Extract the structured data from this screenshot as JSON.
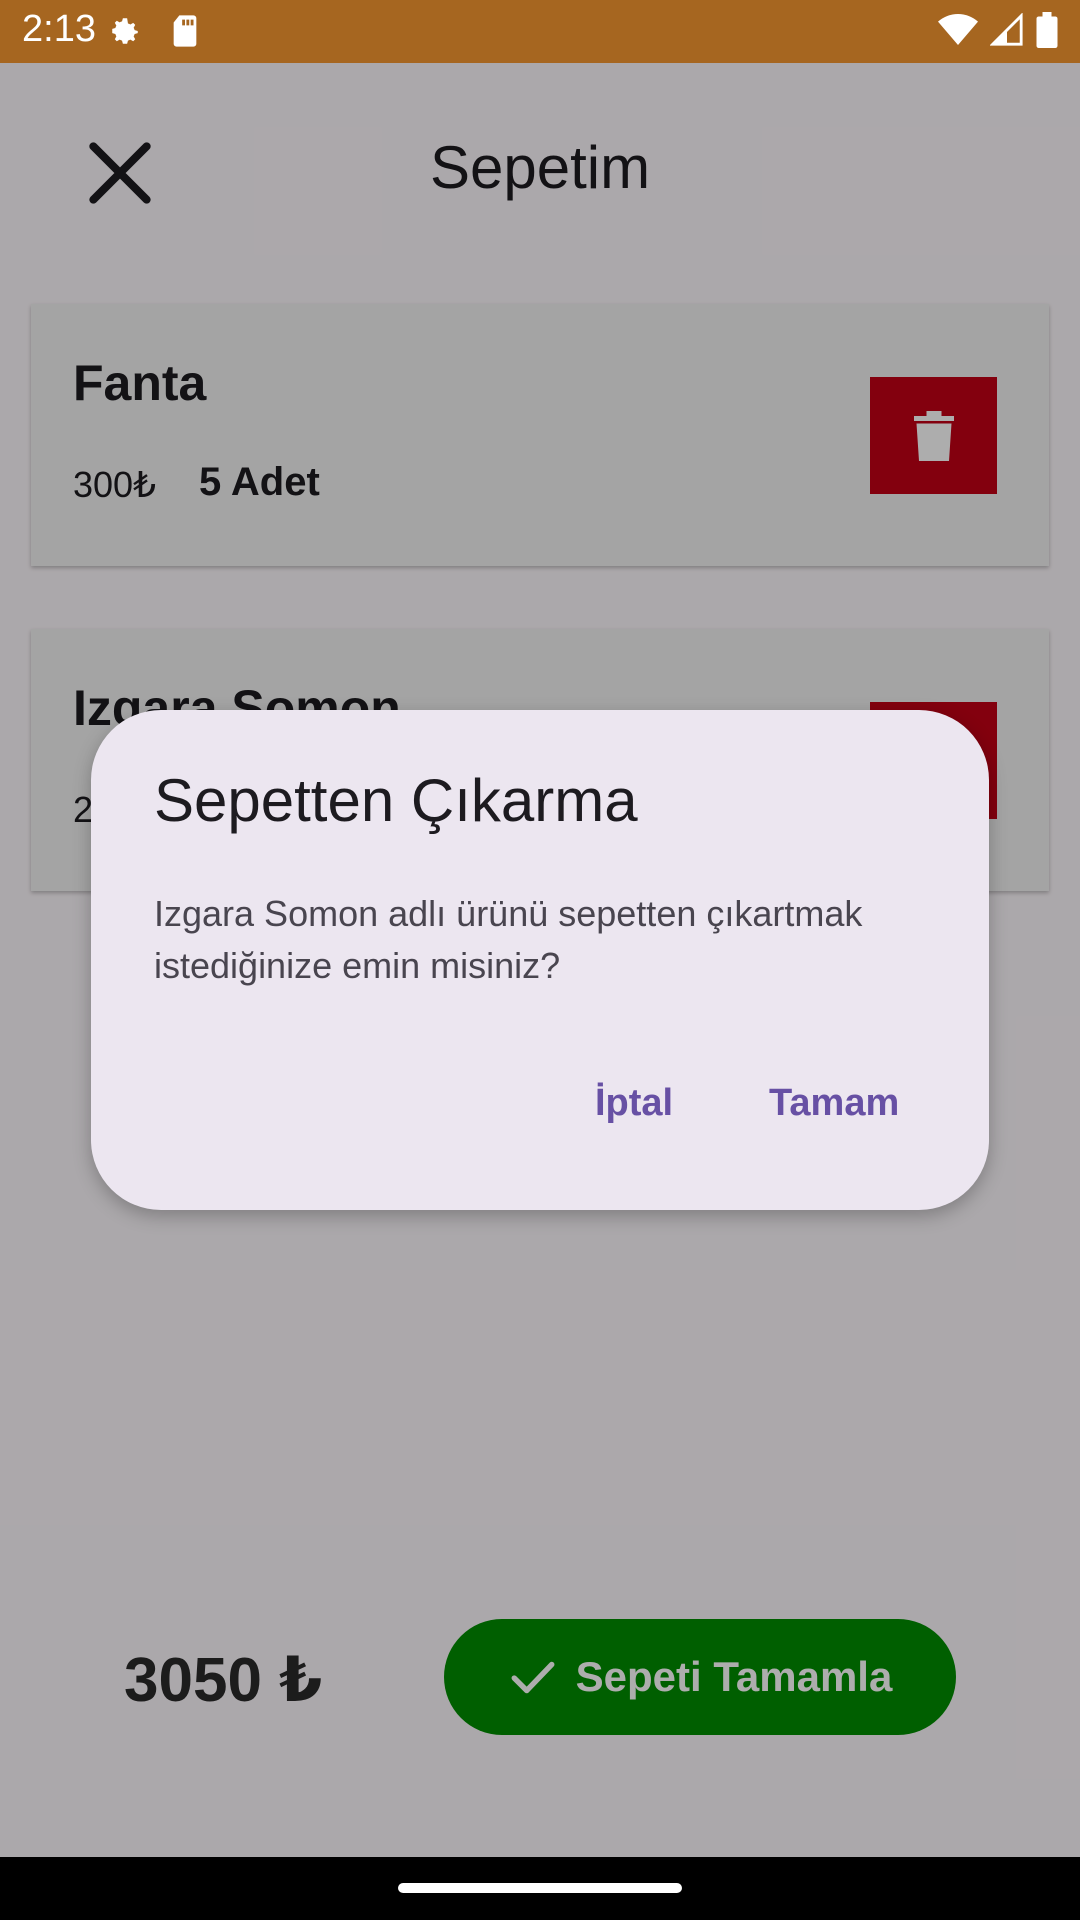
{
  "status": {
    "time": "2:13",
    "icons": [
      "gear-icon",
      "sd-card-icon",
      "wifi-icon",
      "signal-icon",
      "battery-icon"
    ]
  },
  "header": {
    "title": "Sepetim",
    "close_icon": "close-icon"
  },
  "cart": {
    "items": [
      {
        "name": "Fanta",
        "price": "300₺",
        "quantity": "5 Adet"
      },
      {
        "name": "Izgara Somon",
        "price": "2",
        "quantity": ""
      }
    ]
  },
  "footer": {
    "total": "3050 ₺",
    "checkout_label": "Sepeti Tamamla"
  },
  "dialog": {
    "title": "Sepetten Çıkarma",
    "message": "Izgara Somon adlı ürünü sepetten çıkartmak istediğinize emin misiniz?",
    "cancel_label": "İptal",
    "ok_label": "Tamam"
  },
  "colors": {
    "status_bar": "#a66620",
    "delete_button": "#c20016",
    "checkout_button": "#008c00",
    "dialog_background": "#ece6f0",
    "dialog_action": "#6750a4"
  }
}
